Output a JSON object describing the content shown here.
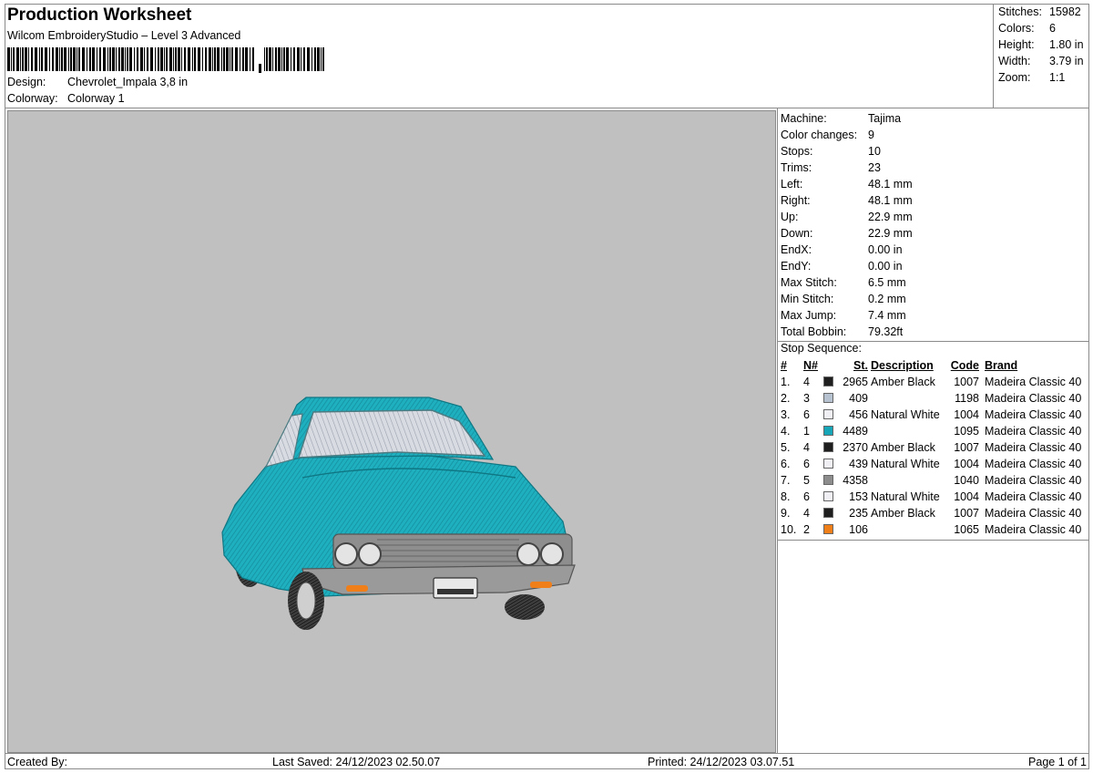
{
  "header": {
    "title": "Production Worksheet",
    "subtitle": "Wilcom EmbroideryStudio – Level 3 Advanced",
    "design_label": "Design:",
    "design_value": "Chevrolet_Impala 3,8 in",
    "colorway_label": "Colorway:",
    "colorway_value": "Colorway 1"
  },
  "stats": {
    "stitches_label": "Stitches:",
    "stitches": "15982",
    "colors_label": "Colors:",
    "colors": "6",
    "height_label": "Height:",
    "height": "1.80 in",
    "width_label": "Width:",
    "width": "3.79 in",
    "zoom_label": "Zoom:",
    "zoom": "1:1"
  },
  "machine_info": [
    {
      "label": "Machine:",
      "value": "Tajima"
    },
    {
      "label": "Color changes:",
      "value": "9"
    },
    {
      "label": "Stops:",
      "value": "10"
    },
    {
      "label": "Trims:",
      "value": "23"
    },
    {
      "label": "Left:",
      "value": "48.1 mm"
    },
    {
      "label": "Right:",
      "value": "48.1 mm"
    },
    {
      "label": "Up:",
      "value": "22.9 mm"
    },
    {
      "label": "Down:",
      "value": "22.9 mm"
    },
    {
      "label": "EndX:",
      "value": "0.00 in"
    },
    {
      "label": "EndY:",
      "value": "0.00 in"
    },
    {
      "label": "Max Stitch:",
      "value": "6.5 mm"
    },
    {
      "label": "Min Stitch:",
      "value": "0.2 mm"
    },
    {
      "label": "Max Jump:",
      "value": "7.4 mm"
    },
    {
      "label": "Total Bobbin:",
      "value": "79.32ft"
    }
  ],
  "stop_sequence": {
    "title": "Stop Sequence:",
    "columns": {
      "num": "#",
      "n": "N#",
      "st": "St.",
      "desc": "Description",
      "code": "Code",
      "brand": "Brand"
    },
    "rows": [
      {
        "num": "1.",
        "n": "4",
        "color": "#1e1e1e",
        "st": "2965",
        "desc": "Amber Black",
        "code": "1007",
        "brand": "Madeira Classic 40"
      },
      {
        "num": "2.",
        "n": "3",
        "color": "#b6c2cf",
        "st": "409",
        "desc": "",
        "code": "1198",
        "brand": "Madeira Classic 40"
      },
      {
        "num": "3.",
        "n": "6",
        "color": "#f0f0f4",
        "st": "456",
        "desc": "Natural White",
        "code": "1004",
        "brand": "Madeira Classic 40"
      },
      {
        "num": "4.",
        "n": "1",
        "color": "#17a5b8",
        "st": "4489",
        "desc": "",
        "code": "1095",
        "brand": "Madeira Classic 40"
      },
      {
        "num": "5.",
        "n": "4",
        "color": "#1e1e1e",
        "st": "2370",
        "desc": "Amber Black",
        "code": "1007",
        "brand": "Madeira Classic 40"
      },
      {
        "num": "6.",
        "n": "6",
        "color": "#f0f0f4",
        "st": "439",
        "desc": "Natural White",
        "code": "1004",
        "brand": "Madeira Classic 40"
      },
      {
        "num": "7.",
        "n": "5",
        "color": "#8c8c8c",
        "st": "4358",
        "desc": "",
        "code": "1040",
        "brand": "Madeira Classic 40"
      },
      {
        "num": "8.",
        "n": "6",
        "color": "#f0f0f4",
        "st": "153",
        "desc": "Natural White",
        "code": "1004",
        "brand": "Madeira Classic 40"
      },
      {
        "num": "9.",
        "n": "4",
        "color": "#1e1e1e",
        "st": "235",
        "desc": "Amber Black",
        "code": "1007",
        "brand": "Madeira Classic 40"
      },
      {
        "num": "10.",
        "n": "2",
        "color": "#f07f1a",
        "st": "106",
        "desc": "",
        "code": "1065",
        "brand": "Madeira Classic 40"
      }
    ]
  },
  "footer": {
    "created_by": "Created By:",
    "last_saved": "Last Saved: 24/12/2023 02.50.07",
    "printed": "Printed: 24/12/2023 03.07.51",
    "page": "Page 1 of 1"
  }
}
